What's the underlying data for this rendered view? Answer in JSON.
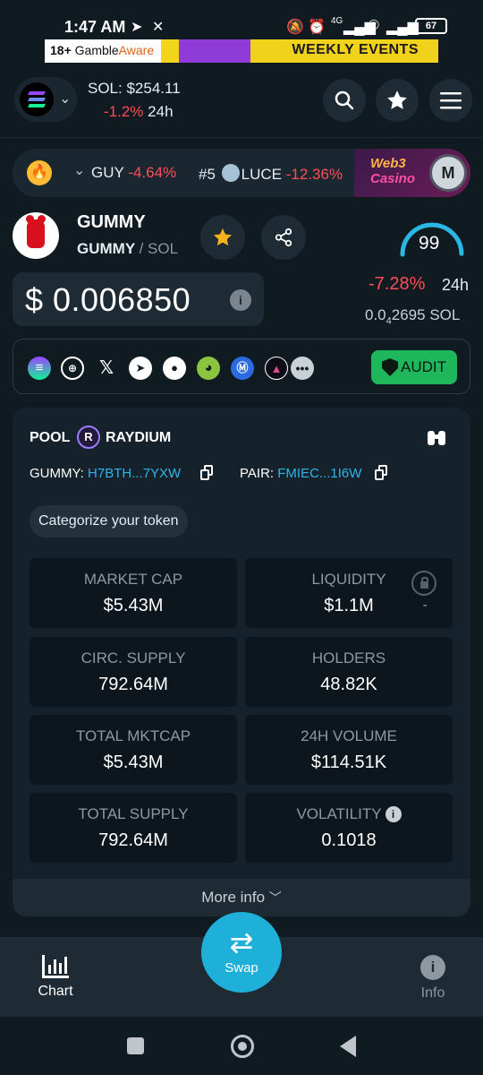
{
  "status_bar": {
    "time": "1:47 AM",
    "network": "4G",
    "battery": "67"
  },
  "ad": {
    "gamble_aware_prefix": "18+",
    "gamble_aware_brand": "Gamble",
    "gamble_aware_suffix": "Aware",
    "weekly_events": "WEEKLY EVENTS"
  },
  "header": {
    "sol_price": "SOL: $254.11",
    "sol_change": "-1.2%",
    "sol_change_period": "24h"
  },
  "ticker": {
    "items": [
      {
        "rank": "",
        "symbol": "GUY",
        "change": "-4.64%"
      },
      {
        "rank": "#5",
        "symbol": "LUCE",
        "change": "-12.36%"
      }
    ],
    "promo_line1": "Web3",
    "promo_line2": "Casino"
  },
  "token": {
    "name": "GUMMY",
    "symbol": "GUMMY",
    "quote": "SOL",
    "price": "$ 0.006850",
    "score": "99",
    "score_fraction": 0.99,
    "change_24h": "-7.28%",
    "change_period": "24h",
    "sol_rate_prefix": "0.0",
    "sol_rate_sub": "4",
    "sol_rate_digits": "2695",
    "sol_rate_unit": "SOL"
  },
  "socials": {
    "icons": [
      "solana-icon",
      "website-icon",
      "x-icon",
      "telegram-icon",
      "reddit-icon",
      "coingecko-icon",
      "coinmarketcap-icon",
      "aggregator-icon",
      "more-icon"
    ],
    "audit_label": "AUDIT"
  },
  "pool": {
    "label": "POOL",
    "dex": "RAYDIUM",
    "token_addr_label": "GUMMY:",
    "token_addr": "H7BTH...7YXW",
    "pair_addr_label": "PAIR:",
    "pair_addr": "FMIEC...1I6W",
    "categorize_label": "Categorize your token",
    "stats": [
      {
        "label": "MARKET CAP",
        "value": "$5.43M"
      },
      {
        "label": "LIQUIDITY",
        "value": "$1.1M",
        "extra": "-"
      },
      {
        "label": "CIRC. SUPPLY",
        "value": "792.64M"
      },
      {
        "label": "HOLDERS",
        "value": "48.82K"
      },
      {
        "label": "TOTAL MKTCAP",
        "value": "$5.43M"
      },
      {
        "label": "24H VOLUME",
        "value": "$114.51K"
      },
      {
        "label": "TOTAL SUPPLY",
        "value": "792.64M"
      },
      {
        "label": "VOLATILITY",
        "value": "0.1018"
      }
    ],
    "more_info": "More info"
  },
  "bottom_nav": {
    "chart": "Chart",
    "swap": "Swap",
    "info": "Info"
  },
  "colors": {
    "accent": "#1fb0d9",
    "negative": "#ff4d57",
    "audit": "#1fb75c",
    "background": "#0f1a21"
  }
}
